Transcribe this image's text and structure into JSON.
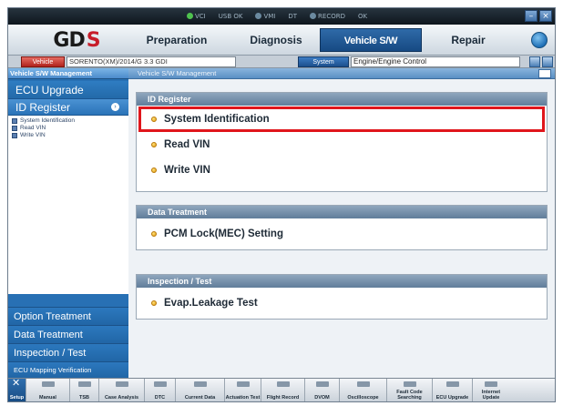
{
  "titlebar": {
    "status": [
      "VCI",
      "USB OK",
      "VMI",
      "DT",
      "RECORD",
      "OK"
    ],
    "buttons": [
      "–",
      "×"
    ]
  },
  "topnav": {
    "logo": "GD",
    "logo_mark": "S",
    "tabs": [
      "Preparation",
      "Diagnosis",
      "Vehicle S/W Management",
      "Repair"
    ],
    "active_tab": "Vehicle S/W Management"
  },
  "vehicle_row": {
    "vehicle_button": "Vehicle",
    "vehicle_value": "SORENTO(XM)/2014/G 3.3 GDI",
    "system_button": "System",
    "system_value": "Engine/Engine Control"
  },
  "sidebar": {
    "header": "Vehicle S/W Management",
    "ecu_upgrade": "ECU Upgrade",
    "id_register": "ID Register",
    "id_register_arrow": "›",
    "submenu": [
      "System Identification",
      "Read VIN",
      "Write VIN"
    ],
    "lower": [
      "Option Treatment",
      "Data Treatment",
      "Inspection / Test",
      "ECU Mapping Verification"
    ]
  },
  "main": {
    "header": "Vehicle S/W Management",
    "panels": [
      {
        "title": "ID Register",
        "items": [
          "System Identification",
          "Read VIN",
          "Write VIN"
        ]
      },
      {
        "title": "Data Treatment",
        "items": [
          "PCM Lock(MEC) Setting"
        ]
      },
      {
        "title": "Inspection / Test",
        "items": [
          "Evap.Leakage Test"
        ]
      }
    ],
    "highlighted_item": "System Identification",
    "highlight_color": "#e0161c"
  },
  "toolbar": {
    "setup": "Setup",
    "buttons": [
      "Manual",
      "TSB",
      "Case Analysis",
      "DTC",
      "Current Data",
      "Actuation Test",
      "Flight Record",
      "DVOM",
      "Oscilloscope",
      "Fault Code Searching",
      "ECU Upgrade",
      "Internet Update"
    ]
  },
  "colors": {
    "accent_blue": "#2870b4",
    "brand_red": "#c71d2a",
    "bullet_orange": "#e09a10"
  }
}
